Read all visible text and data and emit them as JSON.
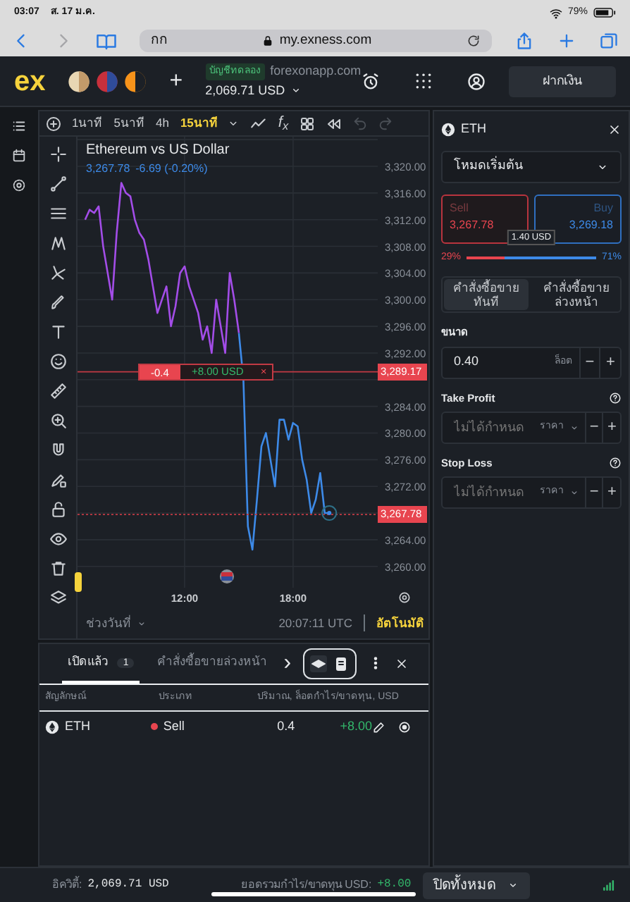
{
  "status_bar": {
    "time": "03:07",
    "date": "ส. 17 ม.ค.",
    "battery": "79%"
  },
  "browser": {
    "reader": "กก",
    "url": "my.exness.com",
    "forward_disabled": true
  },
  "header": {
    "logo": "ex",
    "add": "+",
    "account_type": "บัญชีทดลอง",
    "account_site": "forexonapp.com",
    "balance": "2,069.71 USD",
    "deposit": "ฝากเงิน"
  },
  "chart_toolbar": {
    "timeframes": [
      {
        "label": "1นาที",
        "selected": false
      },
      {
        "label": "5นาที",
        "selected": false
      },
      {
        "label": "4h",
        "selected": false
      },
      {
        "label": "15นาที",
        "selected": true
      }
    ],
    "indicators": "f$_{x}$",
    "redo_disabled": true
  },
  "chart": {
    "title": "Ethereum vs US Dollar",
    "price": "3,267.78",
    "change": "-6.69 (-0.20%)",
    "position_line": {
      "volume": "-0.4",
      "profit": "+8.00 USD",
      "close": "×"
    },
    "chart_data": {
      "type": "line",
      "x": [
        6.5,
        6.75,
        7,
        7.25,
        7.5,
        7.75,
        8,
        8.25,
        8.5,
        8.75,
        9,
        9.25,
        9.5,
        9.75,
        10,
        10.25,
        10.5,
        10.75,
        11,
        11.25,
        11.5,
        11.75,
        12,
        12.25,
        12.5,
        12.75,
        13,
        13.25,
        13.5,
        13.75,
        14,
        14.25,
        14.5,
        14.75,
        15,
        15.25,
        15.5,
        15.75,
        16,
        16.25,
        16.5,
        16.75,
        17,
        17.25,
        17.5,
        17.75,
        18,
        18.25,
        18.5,
        18.75,
        19,
        19.25,
        19.5,
        19.75,
        20
      ],
      "series": [
        {
          "color": "#a34de8",
          "values": [
            3312,
            3313.5,
            3313,
            3314,
            3308,
            3304,
            3300,
            3310,
            3317.5,
            3316,
            3315.5,
            3312,
            3310,
            3309,
            3306,
            3302,
            3298,
            3300,
            3302,
            3296,
            3299,
            3304,
            3305,
            3302,
            3300,
            3298,
            3294,
            3296,
            3292,
            3300,
            3296,
            3292,
            3304,
            3300,
            3295,
            null,
            null,
            null,
            null,
            null,
            null,
            null,
            null,
            null,
            null,
            null,
            null,
            null,
            null,
            null,
            null,
            null,
            null,
            null,
            null
          ]
        },
        {
          "color": "#3d8ae8",
          "values": [
            null,
            null,
            null,
            null,
            null,
            null,
            null,
            null,
            null,
            null,
            null,
            null,
            null,
            null,
            null,
            null,
            null,
            null,
            null,
            null,
            null,
            null,
            null,
            null,
            null,
            null,
            null,
            null,
            null,
            null,
            null,
            null,
            null,
            null,
            3295,
            3288,
            3266,
            3262.5,
            3270,
            3278,
            3280,
            3276,
            3272,
            3282,
            3282,
            3279,
            3281.5,
            3281,
            3276,
            3273,
            3268,
            3270,
            3274,
            3268,
            3268
          ]
        }
      ],
      "xlim": [
        6.08,
        22.68
      ],
      "ylim": [
        3256.8,
        3324.44
      ],
      "xticks": [
        {
          "value": 12,
          "label": "12:00"
        },
        {
          "value": 18,
          "label": "18:00"
        }
      ],
      "yticks": [
        {
          "value": 3260,
          "label": "3,260.00"
        },
        {
          "value": 3264,
          "label": "3,264.00"
        },
        {
          "value": 3272,
          "label": "3,272.00"
        },
        {
          "value": 3276,
          "label": "3,276.00"
        },
        {
          "value": 3280,
          "label": "3,280.00"
        },
        {
          "value": 3284,
          "label": "3,284.00"
        },
        {
          "value": 3292,
          "label": "3,292.00"
        },
        {
          "value": 3296,
          "label": "3,296.00"
        },
        {
          "value": 3300,
          "label": "3,300.00"
        },
        {
          "value": 3304,
          "label": "3,304.00"
        },
        {
          "value": 3308,
          "label": "3,308.00"
        },
        {
          "value": 3312,
          "label": "3,312.00"
        },
        {
          "value": 3316,
          "label": "3,316.00"
        },
        {
          "value": 3320,
          "label": "3,320.00"
        }
      ],
      "grid": true,
      "ref_lines": [
        {
          "axis": "y",
          "value": 3289.17,
          "label": "3,289.17",
          "color": "#c23a44"
        },
        {
          "axis": "y",
          "value": 3267.78,
          "label": "3,267.78",
          "color": "#c23a44"
        }
      ]
    }
  },
  "chart_footer": {
    "date_range": "ช่วงวันที่",
    "time": "20:07:11 UTC",
    "auto": "อัตโนมัติ"
  },
  "order_panel": {
    "symbol": "ETH",
    "mode": "โหมดเริ่มต้น",
    "sell": {
      "label": "Sell",
      "price": "3,267.78"
    },
    "buy": {
      "label": "Buy",
      "price": "3,269.18"
    },
    "spread": "1.40 USD",
    "sentiment": {
      "sell_percent": "29%",
      "buy_percent": "71%",
      "level": 0.29
    },
    "order_types": [
      {
        "label": "คำสั่งซื้อขายทันที",
        "selected": true
      },
      {
        "label": "คำสั่งซื้อขายล่วงหน้า",
        "selected": false
      }
    ],
    "fields": [
      {
        "label": "ขนาด",
        "value": "0.40",
        "unit": "ล็อต",
        "kind": "value",
        "help": false
      },
      {
        "label": "Take Profit",
        "placeholder": "ไม่ได้กำหนด",
        "unit": "ราคา",
        "kind": "select",
        "help": true
      },
      {
        "label": "Stop Loss",
        "placeholder": "ไม่ได้กำหนด",
        "unit": "ราคา",
        "kind": "select",
        "help": true
      }
    ],
    "minus": "−",
    "plus": "+"
  },
  "positions": {
    "tabs": [
      {
        "label": "เปิดแล้ว",
        "count": "1",
        "selected": true
      },
      {
        "label": "คำสั่งซื้อขายล่วงหน้า",
        "selected": false
      }
    ],
    "more": "›",
    "view_modes": [
      {
        "selected": true
      },
      {
        "selected": false
      }
    ],
    "columns": [
      "สัญลักษณ์",
      "ประเภท",
      "ปริมาณ, ล็อต",
      "กำไร/ขาดทุน, USD"
    ],
    "rows": [
      {
        "symbol": "ETH",
        "type": "Sell",
        "volume": "0.4",
        "profit": "+8.00"
      }
    ]
  },
  "footer": {
    "equity_label": "อิควิตี้:",
    "equity": "2,069.71 USD",
    "pl_label": "ยอดรวมกำไร/ขาดทุน USD:",
    "pl": "+8.00",
    "close_all": "ปิดทั้งหมด"
  }
}
